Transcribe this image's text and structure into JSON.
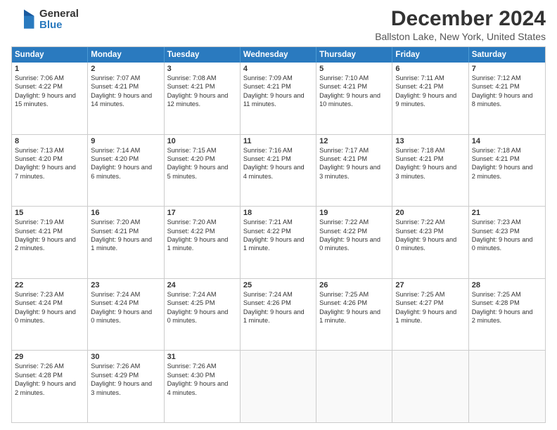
{
  "logo": {
    "general": "General",
    "blue": "Blue"
  },
  "title": "December 2024",
  "subtitle": "Ballston Lake, New York, United States",
  "days": [
    "Sunday",
    "Monday",
    "Tuesday",
    "Wednesday",
    "Thursday",
    "Friday",
    "Saturday"
  ],
  "weeks": [
    [
      {
        "day": "1",
        "sunrise": "Sunrise: 7:06 AM",
        "sunset": "Sunset: 4:22 PM",
        "daylight": "Daylight: 9 hours and 15 minutes."
      },
      {
        "day": "2",
        "sunrise": "Sunrise: 7:07 AM",
        "sunset": "Sunset: 4:21 PM",
        "daylight": "Daylight: 9 hours and 14 minutes."
      },
      {
        "day": "3",
        "sunrise": "Sunrise: 7:08 AM",
        "sunset": "Sunset: 4:21 PM",
        "daylight": "Daylight: 9 hours and 12 minutes."
      },
      {
        "day": "4",
        "sunrise": "Sunrise: 7:09 AM",
        "sunset": "Sunset: 4:21 PM",
        "daylight": "Daylight: 9 hours and 11 minutes."
      },
      {
        "day": "5",
        "sunrise": "Sunrise: 7:10 AM",
        "sunset": "Sunset: 4:21 PM",
        "daylight": "Daylight: 9 hours and 10 minutes."
      },
      {
        "day": "6",
        "sunrise": "Sunrise: 7:11 AM",
        "sunset": "Sunset: 4:21 PM",
        "daylight": "Daylight: 9 hours and 9 minutes."
      },
      {
        "day": "7",
        "sunrise": "Sunrise: 7:12 AM",
        "sunset": "Sunset: 4:21 PM",
        "daylight": "Daylight: 9 hours and 8 minutes."
      }
    ],
    [
      {
        "day": "8",
        "sunrise": "Sunrise: 7:13 AM",
        "sunset": "Sunset: 4:20 PM",
        "daylight": "Daylight: 9 hours and 7 minutes."
      },
      {
        "day": "9",
        "sunrise": "Sunrise: 7:14 AM",
        "sunset": "Sunset: 4:20 PM",
        "daylight": "Daylight: 9 hours and 6 minutes."
      },
      {
        "day": "10",
        "sunrise": "Sunrise: 7:15 AM",
        "sunset": "Sunset: 4:20 PM",
        "daylight": "Daylight: 9 hours and 5 minutes."
      },
      {
        "day": "11",
        "sunrise": "Sunrise: 7:16 AM",
        "sunset": "Sunset: 4:21 PM",
        "daylight": "Daylight: 9 hours and 4 minutes."
      },
      {
        "day": "12",
        "sunrise": "Sunrise: 7:17 AM",
        "sunset": "Sunset: 4:21 PM",
        "daylight": "Daylight: 9 hours and 3 minutes."
      },
      {
        "day": "13",
        "sunrise": "Sunrise: 7:18 AM",
        "sunset": "Sunset: 4:21 PM",
        "daylight": "Daylight: 9 hours and 3 minutes."
      },
      {
        "day": "14",
        "sunrise": "Sunrise: 7:18 AM",
        "sunset": "Sunset: 4:21 PM",
        "daylight": "Daylight: 9 hours and 2 minutes."
      }
    ],
    [
      {
        "day": "15",
        "sunrise": "Sunrise: 7:19 AM",
        "sunset": "Sunset: 4:21 PM",
        "daylight": "Daylight: 9 hours and 2 minutes."
      },
      {
        "day": "16",
        "sunrise": "Sunrise: 7:20 AM",
        "sunset": "Sunset: 4:21 PM",
        "daylight": "Daylight: 9 hours and 1 minute."
      },
      {
        "day": "17",
        "sunrise": "Sunrise: 7:20 AM",
        "sunset": "Sunset: 4:22 PM",
        "daylight": "Daylight: 9 hours and 1 minute."
      },
      {
        "day": "18",
        "sunrise": "Sunrise: 7:21 AM",
        "sunset": "Sunset: 4:22 PM",
        "daylight": "Daylight: 9 hours and 1 minute."
      },
      {
        "day": "19",
        "sunrise": "Sunrise: 7:22 AM",
        "sunset": "Sunset: 4:22 PM",
        "daylight": "Daylight: 9 hours and 0 minutes."
      },
      {
        "day": "20",
        "sunrise": "Sunrise: 7:22 AM",
        "sunset": "Sunset: 4:23 PM",
        "daylight": "Daylight: 9 hours and 0 minutes."
      },
      {
        "day": "21",
        "sunrise": "Sunrise: 7:23 AM",
        "sunset": "Sunset: 4:23 PM",
        "daylight": "Daylight: 9 hours and 0 minutes."
      }
    ],
    [
      {
        "day": "22",
        "sunrise": "Sunrise: 7:23 AM",
        "sunset": "Sunset: 4:24 PM",
        "daylight": "Daylight: 9 hours and 0 minutes."
      },
      {
        "day": "23",
        "sunrise": "Sunrise: 7:24 AM",
        "sunset": "Sunset: 4:24 PM",
        "daylight": "Daylight: 9 hours and 0 minutes."
      },
      {
        "day": "24",
        "sunrise": "Sunrise: 7:24 AM",
        "sunset": "Sunset: 4:25 PM",
        "daylight": "Daylight: 9 hours and 0 minutes."
      },
      {
        "day": "25",
        "sunrise": "Sunrise: 7:24 AM",
        "sunset": "Sunset: 4:26 PM",
        "daylight": "Daylight: 9 hours and 1 minute."
      },
      {
        "day": "26",
        "sunrise": "Sunrise: 7:25 AM",
        "sunset": "Sunset: 4:26 PM",
        "daylight": "Daylight: 9 hours and 1 minute."
      },
      {
        "day": "27",
        "sunrise": "Sunrise: 7:25 AM",
        "sunset": "Sunset: 4:27 PM",
        "daylight": "Daylight: 9 hours and 1 minute."
      },
      {
        "day": "28",
        "sunrise": "Sunrise: 7:25 AM",
        "sunset": "Sunset: 4:28 PM",
        "daylight": "Daylight: 9 hours and 2 minutes."
      }
    ],
    [
      {
        "day": "29",
        "sunrise": "Sunrise: 7:26 AM",
        "sunset": "Sunset: 4:28 PM",
        "daylight": "Daylight: 9 hours and 2 minutes."
      },
      {
        "day": "30",
        "sunrise": "Sunrise: 7:26 AM",
        "sunset": "Sunset: 4:29 PM",
        "daylight": "Daylight: 9 hours and 3 minutes."
      },
      {
        "day": "31",
        "sunrise": "Sunrise: 7:26 AM",
        "sunset": "Sunset: 4:30 PM",
        "daylight": "Daylight: 9 hours and 4 minutes."
      },
      null,
      null,
      null,
      null
    ]
  ]
}
